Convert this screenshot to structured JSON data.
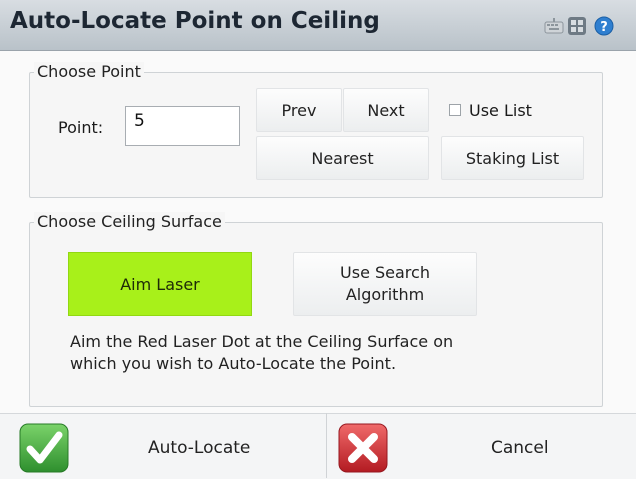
{
  "window": {
    "title": "Auto-Locate Point on Ceiling",
    "title_icons": [
      "keyboard-icon",
      "grid-icon",
      "help-icon"
    ]
  },
  "choose_point": {
    "group_label": "Choose Point",
    "point_label": "Point:",
    "point_value": "5",
    "prev_label": "Prev",
    "next_label": "Next",
    "use_list_label": "Use List",
    "use_list_checked": false,
    "nearest_label": "Nearest",
    "staking_list_label": "Staking List"
  },
  "choose_surface": {
    "group_label": "Choose Ceiling Surface",
    "aim_laser_label": "Aim Laser",
    "use_search_line1": "Use Search",
    "use_search_line2": "Algorithm",
    "description_line1": "Aim the Red Laser Dot at the Ceiling Surface on",
    "description_line2": "which you wish to Auto-Locate the Point."
  },
  "bottom": {
    "auto_locate_label": "Auto-Locate",
    "cancel_label": "Cancel",
    "icons": [
      "checkmark-icon",
      "cancel-x-icon"
    ]
  },
  "colors": {
    "aim_laser_active": "#a8f01a",
    "confirm_green": "#3aa53a",
    "cancel_red": "#c8232a",
    "titlebar": "#c3cbd1"
  }
}
